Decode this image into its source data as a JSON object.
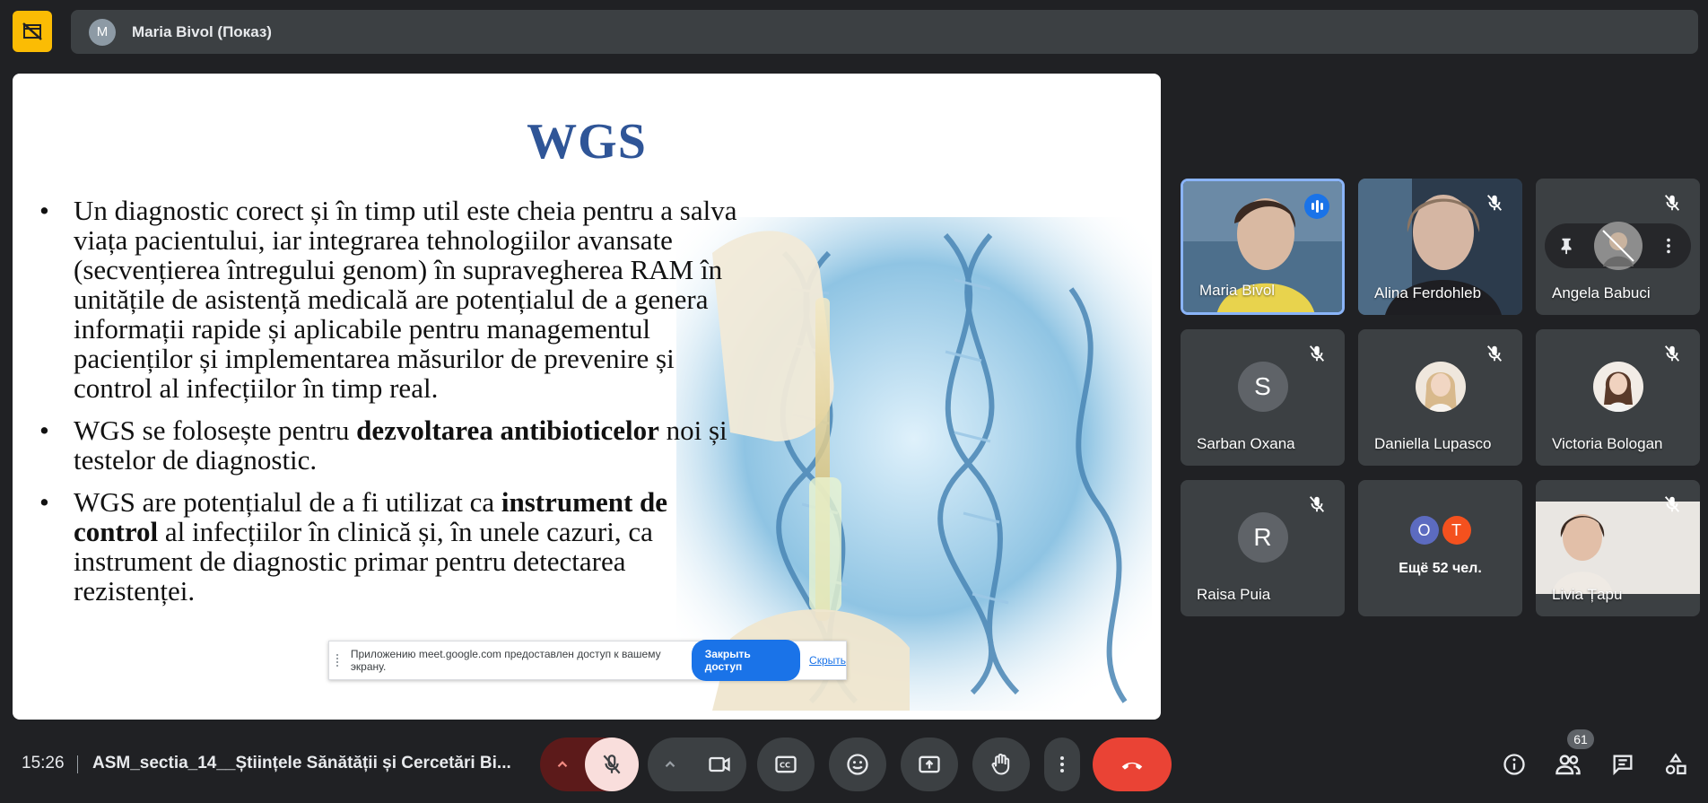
{
  "header": {
    "presenter_initial": "M",
    "presenter_label": "Maria Bivol (Показ)"
  },
  "slide": {
    "title": "WGS",
    "bullets": [
      {
        "parts": [
          {
            "text": "Un diagnostic corect și în timp util este cheia pentru a salva viața pacientului, iar integrarea tehnologiilor avansate (secvențierea întregului genom) în supravegherea RAM în unitățile de asistență medicală are potențialul de a genera informații rapide și aplicabile pentru managementul pacienților și implementarea măsurilor de prevenire și control al infecțiilor în timp real.",
            "bold": false
          }
        ]
      },
      {
        "parts": [
          {
            "text": "WGS se folosește pentru ",
            "bold": false
          },
          {
            "text": "dezvoltarea antibioticelor",
            "bold": true
          },
          {
            "text": " noi și testelor de diagnostic.",
            "bold": false
          }
        ]
      },
      {
        "parts": [
          {
            "text": "WGS are potențialul de a fi utilizat ca ",
            "bold": false
          },
          {
            "text": "instrument de control",
            "bold": true
          },
          {
            "text": " al infecțiilor în clinică și, în unele cazuri, ca instrument de diagnostic primar pentru detectarea rezistenței.",
            "bold": false
          }
        ]
      }
    ]
  },
  "share_notice": {
    "text": "Приложению meet.google.com предоставлен доступ к вашему экрану.",
    "stop_label": "Закрыть доступ",
    "hide_label": "Скрыть"
  },
  "participants": [
    {
      "name": "Maria Bivol"
    },
    {
      "name": "Alina Ferdohleb"
    },
    {
      "name": "Angela Babuci"
    },
    {
      "name": "Sarban Oxana",
      "initial": "S"
    },
    {
      "name": "Daniella Lupasco"
    },
    {
      "name": "Victoria Bologan"
    },
    {
      "name": "Raisa Puia",
      "initial": "R"
    },
    {
      "more_label": "Ещё 52 чел.",
      "initials": [
        "O",
        "T"
      ],
      "colors": [
        "#5c6bc0",
        "#f4511e"
      ]
    },
    {
      "name": "Livia Țapu"
    }
  ],
  "footer": {
    "time": "15:26",
    "meeting_title": "ASM_sectia_14__Științele Sănătății și Cercetări Bi...",
    "participant_count": "61"
  },
  "colors": {
    "background": "#202124",
    "tile": "#3c4043",
    "accent": "#1a73e8",
    "leave": "#ea4335",
    "mic_muted": "#f9dedc",
    "camera_off": "#fbbc04"
  },
  "icons": [
    "camera-off-icon",
    "mic-off-icon",
    "video-icon",
    "captions-icon",
    "emoji-icon",
    "present-icon",
    "raise-hand-icon",
    "more-vert-icon",
    "call-end-icon",
    "info-icon",
    "people-icon",
    "chat-icon",
    "activities-icon",
    "pin-icon",
    "speaking-icon"
  ]
}
